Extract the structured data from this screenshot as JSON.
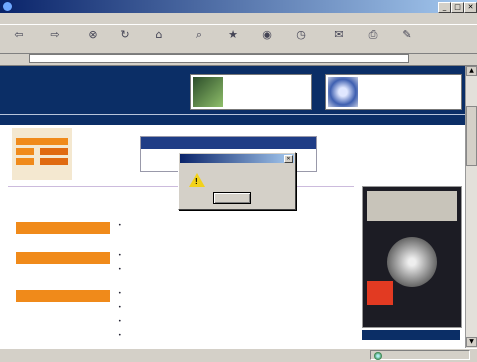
{
  "window": {
    "title": "",
    "controls": [
      "_",
      "□",
      "✕"
    ]
  },
  "menubar": {
    "items": [
      "",
      "",
      "",
      "",
      "",
      ""
    ]
  },
  "toolbar": {
    "buttons": [
      {
        "label": "",
        "icon": "back-icon"
      },
      {
        "label": "",
        "icon": "forward-icon"
      },
      {
        "label": "",
        "icon": "stop-icon"
      },
      {
        "label": "",
        "icon": "refresh-icon"
      },
      {
        "label": "",
        "icon": "home-icon"
      },
      {
        "label": "",
        "icon": "search-icon"
      },
      {
        "label": "",
        "icon": "favorites-icon"
      },
      {
        "label": "",
        "icon": "media-icon"
      },
      {
        "label": "",
        "icon": "history-icon"
      },
      {
        "label": "",
        "icon": "mail-icon"
      },
      {
        "label": "",
        "icon": "print-icon"
      },
      {
        "label": "",
        "icon": "edit-icon"
      }
    ]
  },
  "addressbar": {
    "label": "",
    "value": "",
    "go_label": "",
    "links_label": ""
  },
  "site": {
    "logo_main": "",
    "logo_accent": "",
    "tagline": "",
    "ad1_text": "",
    "ad2_text": "",
    "nav_item": "",
    "left_logo_caption": "",
    "left_logo_footer": "",
    "banner3_line1": "",
    "banner3_line2": "",
    "banner4_line1": "",
    "banner4_line2": "",
    "banner4_url": "",
    "heading_left": "",
    "heading_right": "",
    "sections": [
      {
        "title": "",
        "links": [
          "",
          ""
        ]
      },
      {
        "title": "",
        "links": [
          "",
          ""
        ]
      },
      {
        "title": "",
        "links": [
          "",
          "",
          "",
          ""
        ]
      }
    ],
    "magazine_mark": "",
    "archive_label": ""
  },
  "dialog": {
    "title": "",
    "message": "",
    "ok_label": "",
    "icon": "warning-icon"
  },
  "statusbar": {
    "zone": ""
  },
  "colors": {
    "accent": "#f08a1a",
    "site_navy": "#0b2e66",
    "title_blue": "#0a246a"
  }
}
